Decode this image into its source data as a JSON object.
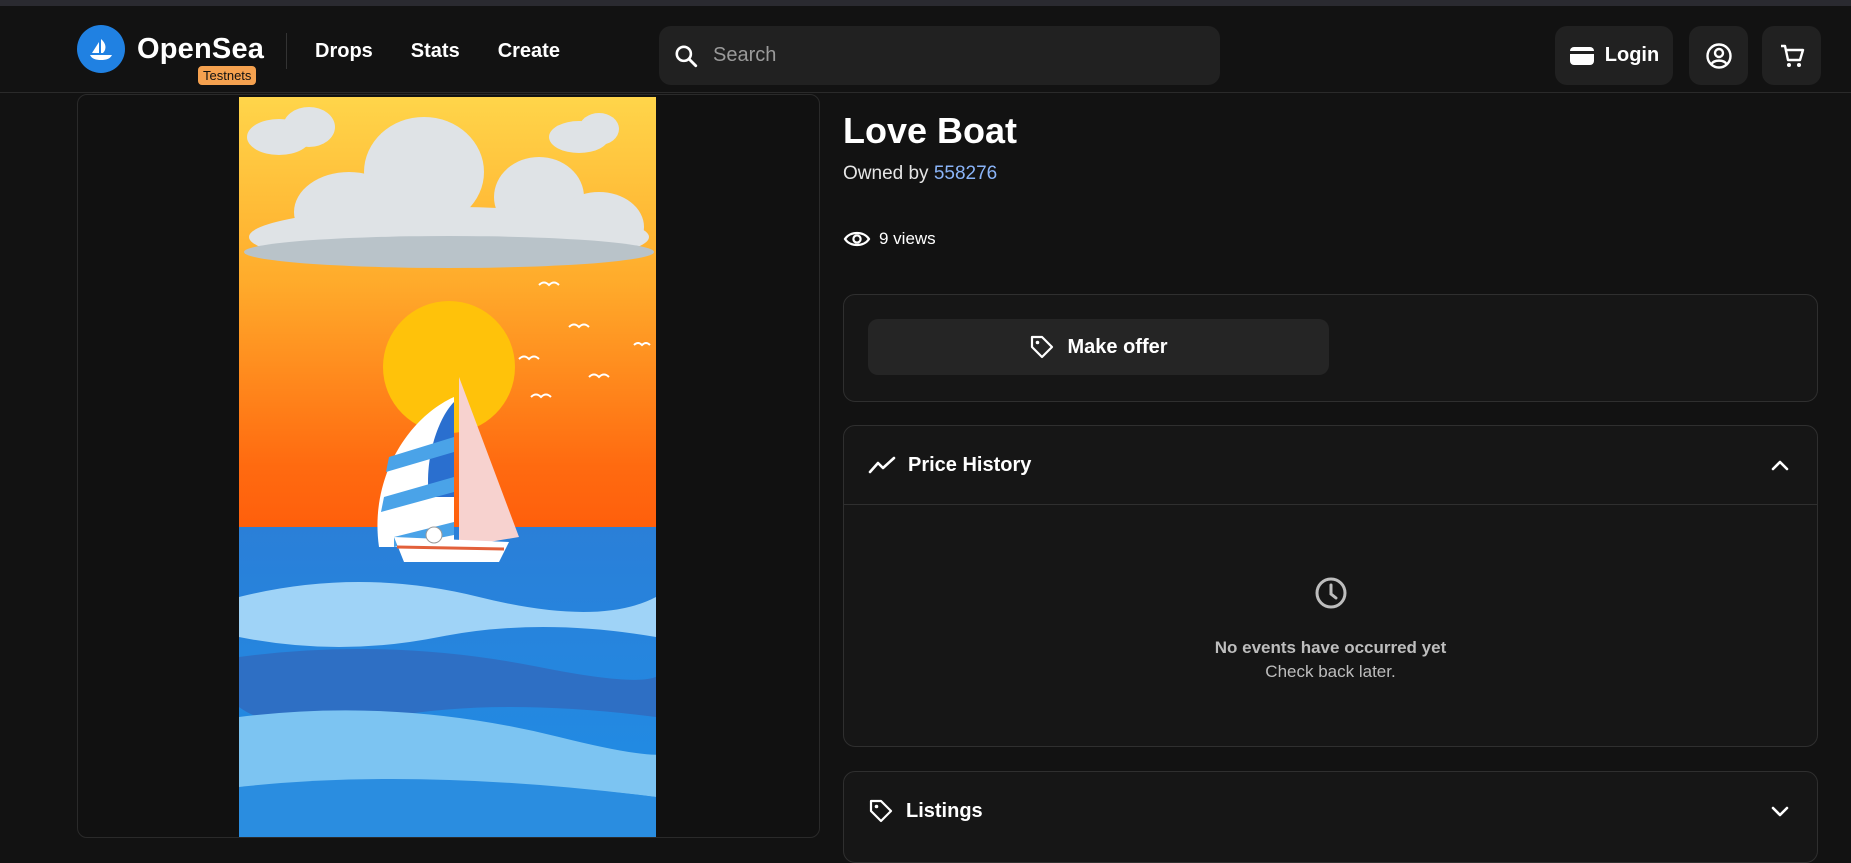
{
  "header": {
    "brand": "OpenSea",
    "badge": "Testnets",
    "nav": [
      "Drops",
      "Stats",
      "Create"
    ],
    "search_placeholder": "Search",
    "login_label": "Login"
  },
  "item": {
    "title": "Love Boat",
    "owned_by_label": "Owned by",
    "owner": "558276",
    "views": "9 views"
  },
  "actions": {
    "make_offer": "Make offer"
  },
  "price_history": {
    "title": "Price History",
    "empty_title": "No events have occurred yet",
    "empty_subtitle": "Check back later."
  },
  "listings": {
    "title": "Listings"
  },
  "colors": {
    "accent": "#2081e2",
    "badge": "#f5a14f",
    "owner_link": "#8ab4f8",
    "background": "#121212"
  },
  "icons": [
    "opensea-logo-icon",
    "search-icon",
    "wallet-icon",
    "account-icon",
    "cart-icon",
    "eye-icon",
    "tag-icon",
    "trend-icon",
    "chevron-up-icon",
    "clock-icon",
    "chevron-down-icon"
  ]
}
